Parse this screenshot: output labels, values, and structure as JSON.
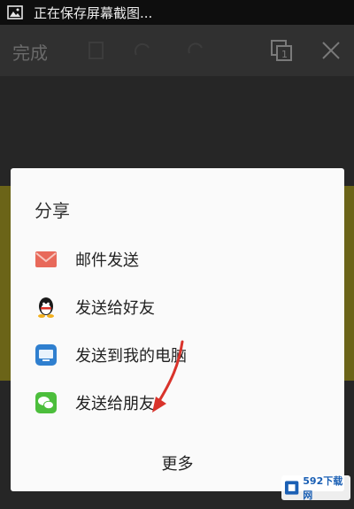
{
  "status_bar": {
    "notification_text": "正在保存屏幕截图...",
    "icon": "image-icon"
  },
  "toolbar": {
    "done_label": "完成",
    "icons": [
      "copy-icon",
      "rotate-icon",
      "redo-icon",
      "crop-icon",
      "close-icon"
    ]
  },
  "share_sheet": {
    "title": "分享",
    "items": [
      {
        "label": "邮件发送",
        "icon": "mail-icon",
        "color": "#e8695a"
      },
      {
        "label": "发送给好友",
        "icon": "qq-icon",
        "color": "#1a1a1a"
      },
      {
        "label": "发送到我的电脑",
        "icon": "computer-icon",
        "color": "#2f7fcf"
      },
      {
        "label": "发送给朋友",
        "icon": "wechat-icon",
        "color": "#4cbe3c"
      }
    ],
    "more_label": "更多"
  },
  "watermark": {
    "text": "592下载网"
  }
}
